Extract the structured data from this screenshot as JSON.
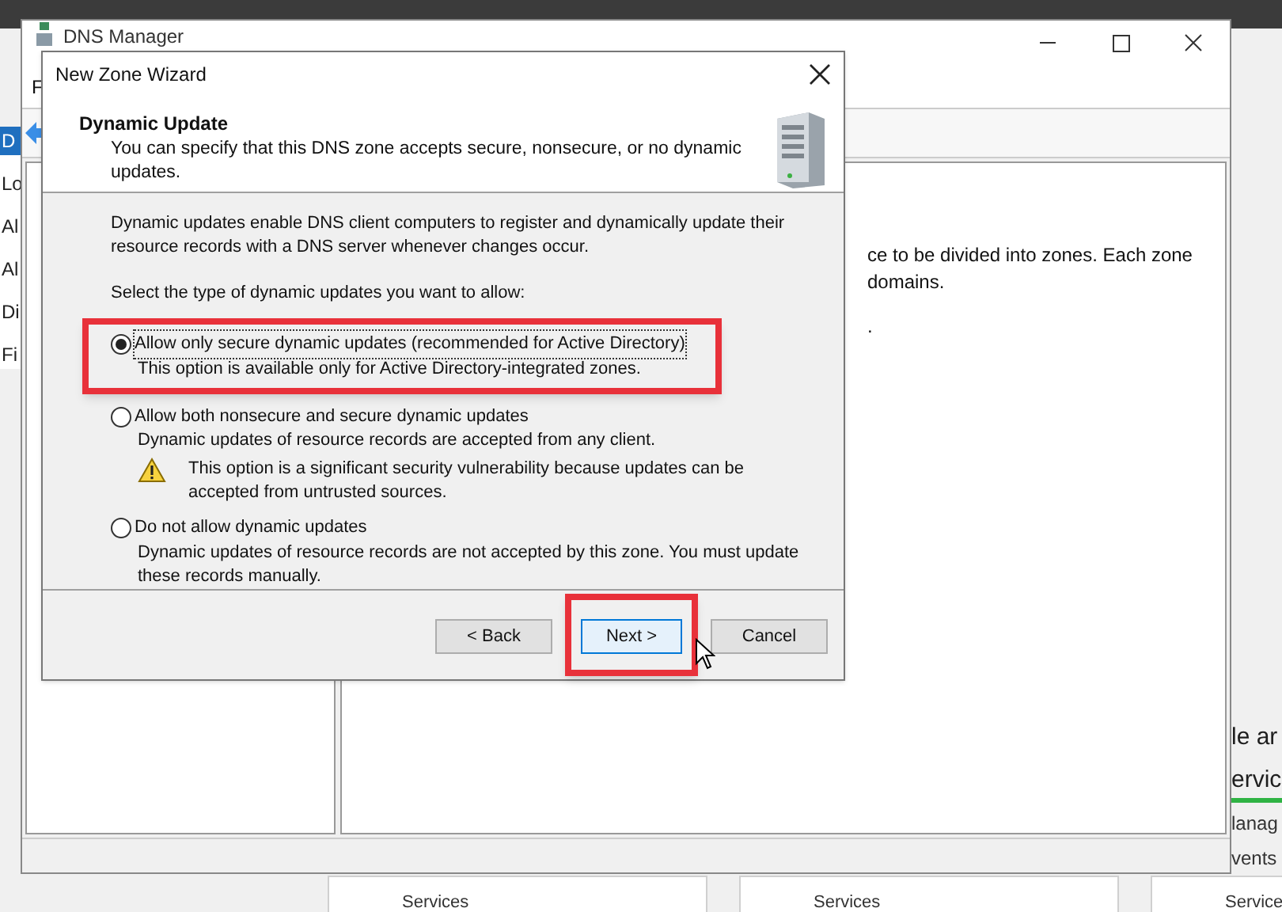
{
  "server_manager": {
    "nav_items": [
      {
        "label": "D",
        "selected": true
      },
      {
        "label": "Lo",
        "selected": false
      },
      {
        "label": "Al",
        "selected": false
      },
      {
        "label": "Al",
        "selected": false
      },
      {
        "label": "Di",
        "selected": false
      },
      {
        "label": "Fi",
        "selected": false
      }
    ],
    "side_texts": [
      {
        "text": "le ar",
        "kind": "title"
      },
      {
        "text": "ervic",
        "kind": "link"
      },
      {
        "text": "lanag",
        "kind": "item"
      },
      {
        "text": "vents",
        "kind": "item"
      }
    ],
    "tiles": [
      "Services",
      "Services",
      "Service"
    ]
  },
  "dns_manager": {
    "title": "DNS Manager",
    "menu": [
      "F"
    ],
    "content_lines": [
      "ce to be divided into zones. Each zone",
      "domains.",
      "."
    ]
  },
  "wizard": {
    "title": "New Zone Wizard",
    "heading": "Dynamic Update",
    "subtitle": "You can specify that this DNS zone accepts secure, nonsecure, or no dynamic updates.",
    "intro": "Dynamic updates enable DNS client computers to register and dynamically update their resource records with a DNS server whenever changes occur.",
    "prompt": "Select the type of dynamic updates you want to allow:",
    "options": [
      {
        "label": "Allow only secure dynamic updates (recommended for Active Directory)",
        "description": "This option is available only for Active Directory-integrated zones.",
        "selected": true,
        "focused": true,
        "highlighted": true
      },
      {
        "label": "Allow both nonsecure and secure dynamic updates",
        "description": "Dynamic updates of resource records are accepted from any client.",
        "warning": "This option is a significant security vulnerability because updates can be accepted from untrusted sources.",
        "selected": false,
        "focused": false,
        "highlighted": false
      },
      {
        "label": "Do not allow dynamic updates",
        "description": "Dynamic updates of resource records are not accepted by this zone. You must update these records manually.",
        "selected": false,
        "focused": false,
        "highlighted": false
      }
    ],
    "buttons": [
      {
        "label": "< Back",
        "focused": false,
        "highlighted": false
      },
      {
        "label": "Next >",
        "focused": true,
        "highlighted": true
      },
      {
        "label": "Cancel",
        "focused": false,
        "highlighted": false
      }
    ]
  }
}
